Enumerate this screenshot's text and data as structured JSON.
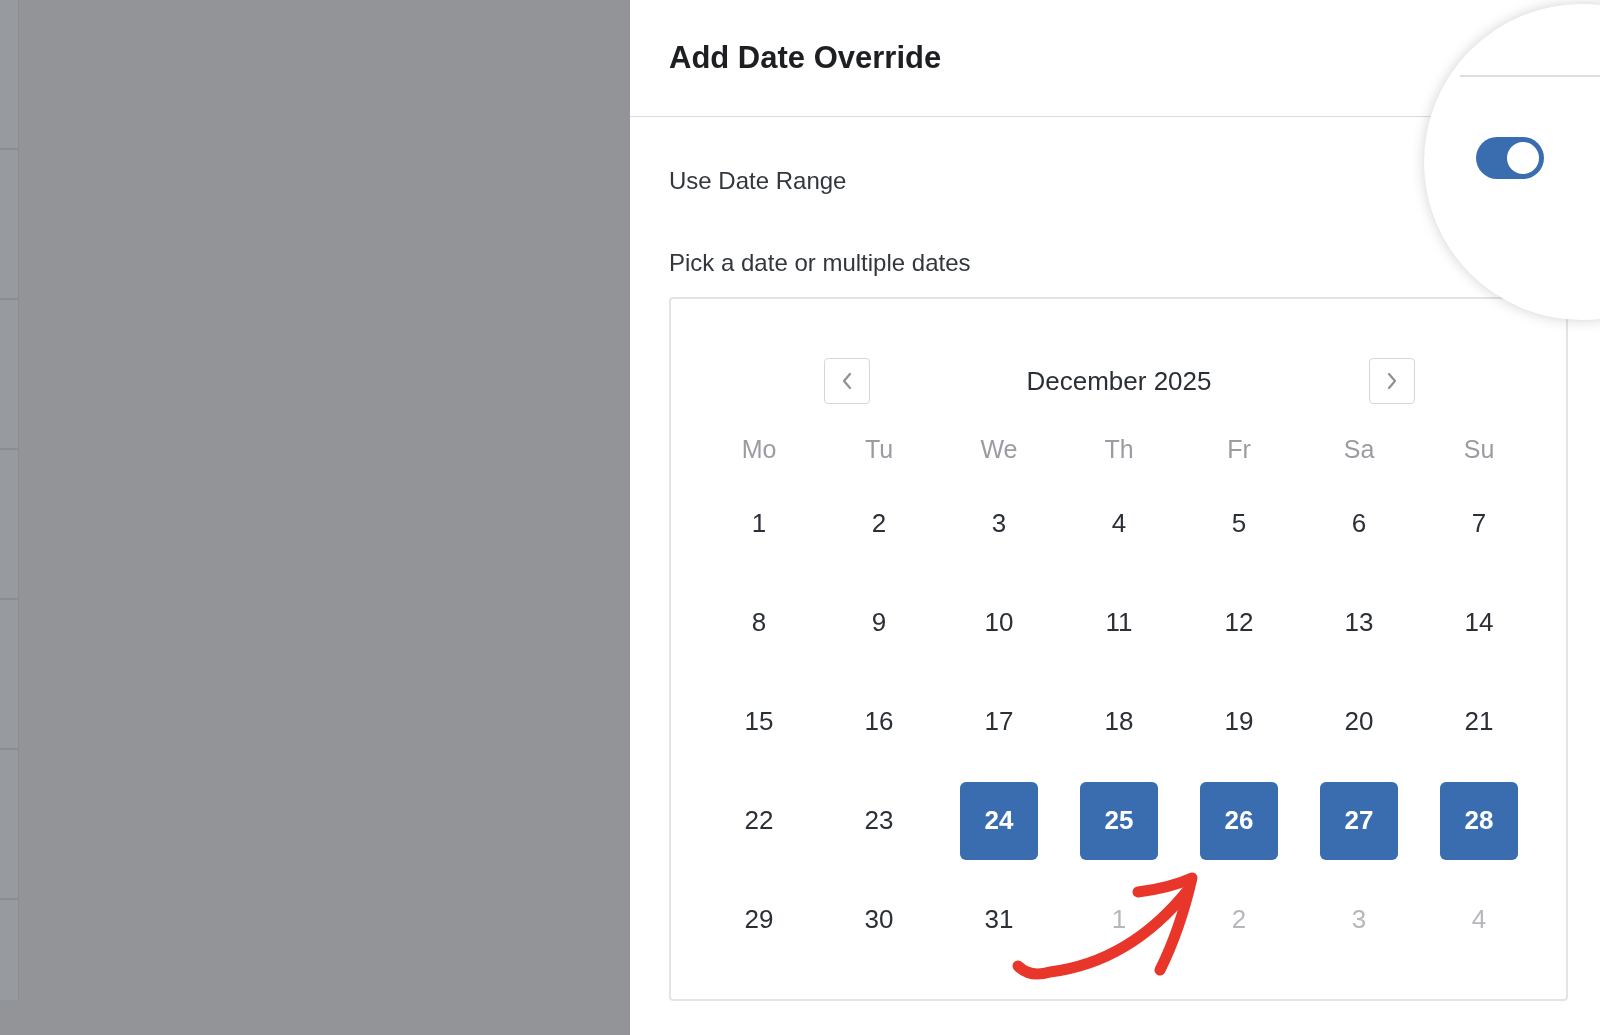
{
  "panel": {
    "title": "Add Date Override"
  },
  "use_date_range": {
    "label": "Use Date Range",
    "on": true
  },
  "picker": {
    "label": "Pick a date or multiple dates"
  },
  "calendar": {
    "month": "December 2025",
    "weekdays": [
      "Mo",
      "Tu",
      "We",
      "Th",
      "Fr",
      "Sa",
      "Su"
    ],
    "weeks": [
      [
        {
          "label": "1",
          "selected": false,
          "outside": false
        },
        {
          "label": "2",
          "selected": false,
          "outside": false
        },
        {
          "label": "3",
          "selected": false,
          "outside": false
        },
        {
          "label": "4",
          "selected": false,
          "outside": false
        },
        {
          "label": "5",
          "selected": false,
          "outside": false
        },
        {
          "label": "6",
          "selected": false,
          "outside": false
        },
        {
          "label": "7",
          "selected": false,
          "outside": false
        }
      ],
      [
        {
          "label": "8",
          "selected": false,
          "outside": false
        },
        {
          "label": "9",
          "selected": false,
          "outside": false
        },
        {
          "label": "10",
          "selected": false,
          "outside": false
        },
        {
          "label": "11",
          "selected": false,
          "outside": false
        },
        {
          "label": "12",
          "selected": false,
          "outside": false
        },
        {
          "label": "13",
          "selected": false,
          "outside": false
        },
        {
          "label": "14",
          "selected": false,
          "outside": false
        }
      ],
      [
        {
          "label": "15",
          "selected": false,
          "outside": false
        },
        {
          "label": "16",
          "selected": false,
          "outside": false
        },
        {
          "label": "17",
          "selected": false,
          "outside": false
        },
        {
          "label": "18",
          "selected": false,
          "outside": false
        },
        {
          "label": "19",
          "selected": false,
          "outside": false
        },
        {
          "label": "20",
          "selected": false,
          "outside": false
        },
        {
          "label": "21",
          "selected": false,
          "outside": false
        }
      ],
      [
        {
          "label": "22",
          "selected": false,
          "outside": false
        },
        {
          "label": "23",
          "selected": false,
          "outside": false
        },
        {
          "label": "24",
          "selected": true,
          "outside": false
        },
        {
          "label": "25",
          "selected": true,
          "outside": false
        },
        {
          "label": "26",
          "selected": true,
          "outside": false
        },
        {
          "label": "27",
          "selected": true,
          "outside": false
        },
        {
          "label": "28",
          "selected": true,
          "outside": false
        }
      ],
      [
        {
          "label": "29",
          "selected": false,
          "outside": false
        },
        {
          "label": "30",
          "selected": false,
          "outside": false
        },
        {
          "label": "31",
          "selected": false,
          "outside": false
        },
        {
          "label": "1",
          "selected": false,
          "outside": true
        },
        {
          "label": "2",
          "selected": false,
          "outside": true
        },
        {
          "label": "3",
          "selected": false,
          "outside": true
        },
        {
          "label": "4",
          "selected": false,
          "outside": true
        }
      ]
    ]
  }
}
